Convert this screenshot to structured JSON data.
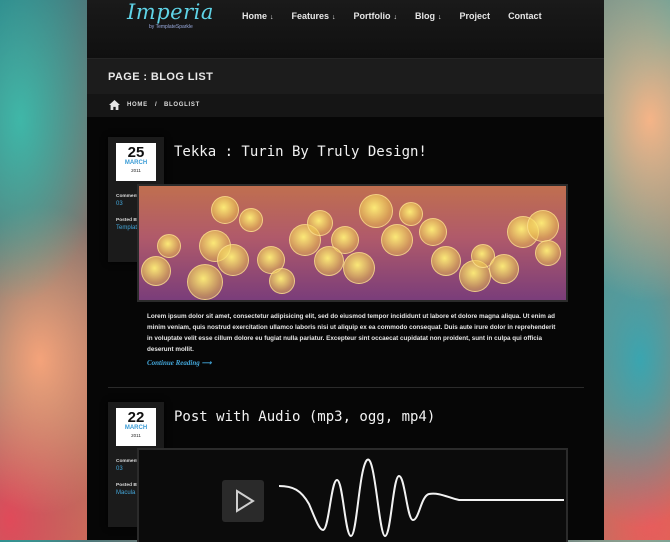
{
  "header": {
    "logo": "Imperia",
    "logo_sub": "by TemplateSparkle",
    "nav": [
      {
        "label": "Home",
        "has_arrow": true
      },
      {
        "label": "Features",
        "has_arrow": true
      },
      {
        "label": "Portfolio",
        "has_arrow": true
      },
      {
        "label": "Blog",
        "has_arrow": true
      },
      {
        "label": "Project",
        "has_arrow": false
      },
      {
        "label": "Contact",
        "has_arrow": false
      }
    ]
  },
  "page": {
    "title": "PAGE : BLOG LIST",
    "breadcrumb": [
      "HOME",
      "/",
      "BLOGLIST"
    ]
  },
  "posts": [
    {
      "day": "25",
      "month": "MARCH",
      "year": "2011",
      "comments_label": "Comments --",
      "comments": "03",
      "posted_label": "Posted By --",
      "author": "TemplateSparkle",
      "title": "Tekka : Turin By Truly Design!",
      "excerpt": "Lorem ipsum dolor sit amet, consectetur adipisicing elit, sed do eiusmod tempor incididunt ut labore et dolore magna aliqua. Ut enim ad minim veniam, quis nostrud exercitation ullamco laboris nisi ut aliquip ex ea commodo consequat. Duis aute irure dolor in reprehenderit in voluptate velit esse cillum dolore eu fugiat nulla pariatur. Excepteur sint occaecat cupidatat non proident, sunt in culpa qui officia deserunt mollit.",
      "more": "Continue Reading ⟶"
    },
    {
      "day": "22",
      "month": "MARCH",
      "year": "2011",
      "comments_label": "Comments --",
      "comments": "03",
      "posted_label": "Posted By --",
      "author": "Macula",
      "title": "Post with Audio (mp3, ogg, mp4)"
    }
  ],
  "colors": {
    "accent": "#43a6d9",
    "logo": "#5fd3e6",
    "background": "#060606"
  }
}
